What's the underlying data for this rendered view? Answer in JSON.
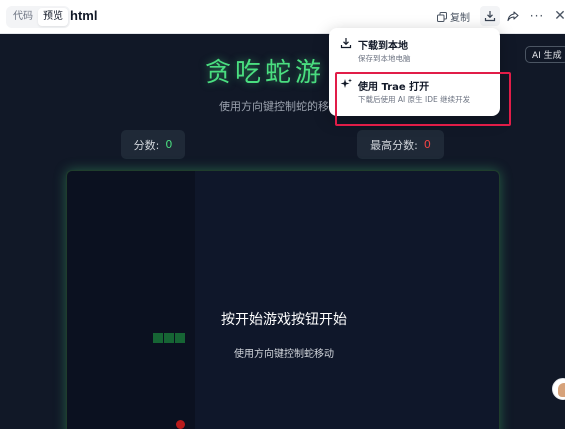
{
  "toolbar": {
    "tabs": [
      {
        "label": "代码",
        "active": false
      },
      {
        "label": "预览",
        "active": true
      }
    ],
    "filename": "html",
    "copy_label": "复制",
    "icons": [
      "copy-icon",
      "download-icon",
      "share-icon",
      "more-icon",
      "close-icon"
    ]
  },
  "game": {
    "title": "贪吃蛇游",
    "subtitle": "使用方向键控制蛇的移",
    "score_label": "分数:",
    "score_value": "0",
    "high_score_label": "最高分数:",
    "high_score_value": "0",
    "overlay_title": "按开始游戏按钮开始",
    "overlay_subtitle": "使用方向键控制蛇移动",
    "colors": {
      "accent": "#4ade80",
      "high_score": "#ef4444",
      "background": "#111827"
    }
  },
  "ai_badge": "AI 生成",
  "menu": {
    "items": [
      {
        "icon": "download-icon",
        "title": "下载到本地",
        "desc": "保存到本地电脑"
      },
      {
        "icon": "sparkle-icon",
        "title": "使用 Trae 打开",
        "desc": "下载后使用 AI 原生 IDE 继续开发"
      }
    ],
    "highlight_color": "#e11d48"
  }
}
